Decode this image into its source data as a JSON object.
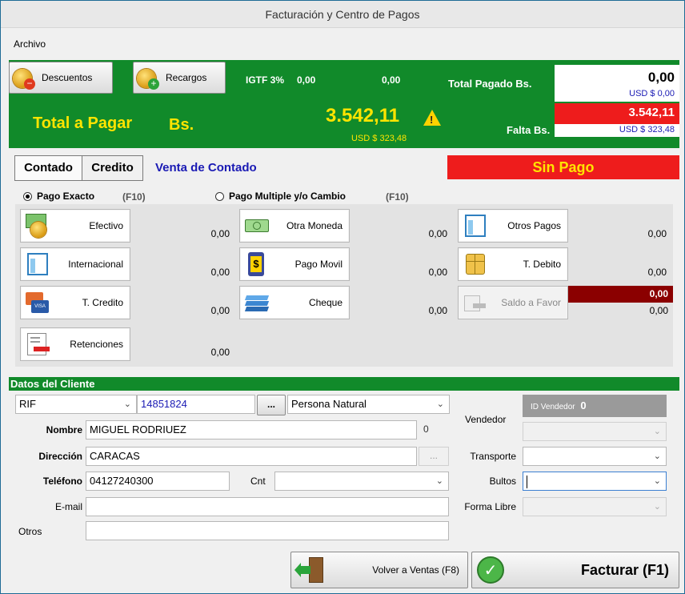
{
  "window": {
    "title": "Facturación y Centro de Pagos"
  },
  "menu": {
    "archivo": "Archivo"
  },
  "summary": {
    "descuentos_label": "Descuentos",
    "recargos_label": "Recargos",
    "igtf_label": "IGTF 3%",
    "igtf_value": "0,00",
    "igtf_amount": "0,00",
    "total_label": "Total a Pagar",
    "currency_label": "Bs.",
    "total_value": "3.542,11",
    "total_usd": "USD $ 323,48",
    "total_pagado_label": "Total Pagado Bs.",
    "total_pagado_value": "0,00",
    "total_pagado_usd": "USD $ 0,00",
    "falta_label": "Falta Bs.",
    "falta_value": "3.542,11",
    "falta_usd": "USD $ 323,48"
  },
  "tabs": {
    "contado": "Contado",
    "credito": "Credito",
    "mode_label": "Venta de Contado",
    "status": "Sin Pago"
  },
  "payment_mode": {
    "exacto_label": "Pago Exacto",
    "exacto_key": "(F10)",
    "multiple_label": "Pago Multiple y/o Cambio",
    "multiple_key": "(F10)"
  },
  "payments": {
    "efectivo": {
      "label": "Efectivo",
      "value": "0,00"
    },
    "otra_moneda": {
      "label": "Otra Moneda",
      "value": "0,00"
    },
    "otros_pagos": {
      "label": "Otros Pagos",
      "value": "0,00"
    },
    "internacional": {
      "label": "Internacional",
      "value": "0,00"
    },
    "pago_movil": {
      "label": "Pago Movil",
      "value": "0,00"
    },
    "t_debito": {
      "label": "T. Debito",
      "value": "0,00"
    },
    "t_credito": {
      "label": "T. Credito",
      "value": "0,00"
    },
    "cheque": {
      "label": "Cheque",
      "value": "0,00"
    },
    "saldo_favor": {
      "label": "Saldo a Favor",
      "value_top": "0,00",
      "value_bottom": "0,00"
    },
    "retenciones": {
      "label": "Retenciones",
      "value": "0,00"
    }
  },
  "client": {
    "header": "Datos del Cliente",
    "doc_type": "RIF",
    "doc_number": "14851824",
    "dots_label": "...",
    "person_type": "Persona Natural",
    "nombre_label": "Nombre",
    "nombre_value": "MIGUEL RODRIUEZ",
    "nombre_count": "0",
    "direccion_label": "Dirección",
    "direccion_value": "CARACAS",
    "direccion_dots": "...",
    "telefono_label": "Teléfono",
    "telefono_value": "04127240300",
    "cnt_label": "Cnt",
    "email_label": "E-mail",
    "otros_label": "Otros"
  },
  "right_panel": {
    "id_vendedor_label": "ID Vendedor",
    "id_vendedor_value": "0",
    "vendedor_label": "Vendedor",
    "transporte_label": "Transporte",
    "bultos_label": "Bultos",
    "forma_libre_label": "Forma Libre"
  },
  "actions": {
    "volver": "Volver a Ventas (F8)",
    "facturar": "Facturar (F1)"
  },
  "colors": {
    "green": "#118a2a",
    "red": "#ee1c1c",
    "yellow": "#ffe400",
    "blue_text": "#1a1ab4"
  }
}
